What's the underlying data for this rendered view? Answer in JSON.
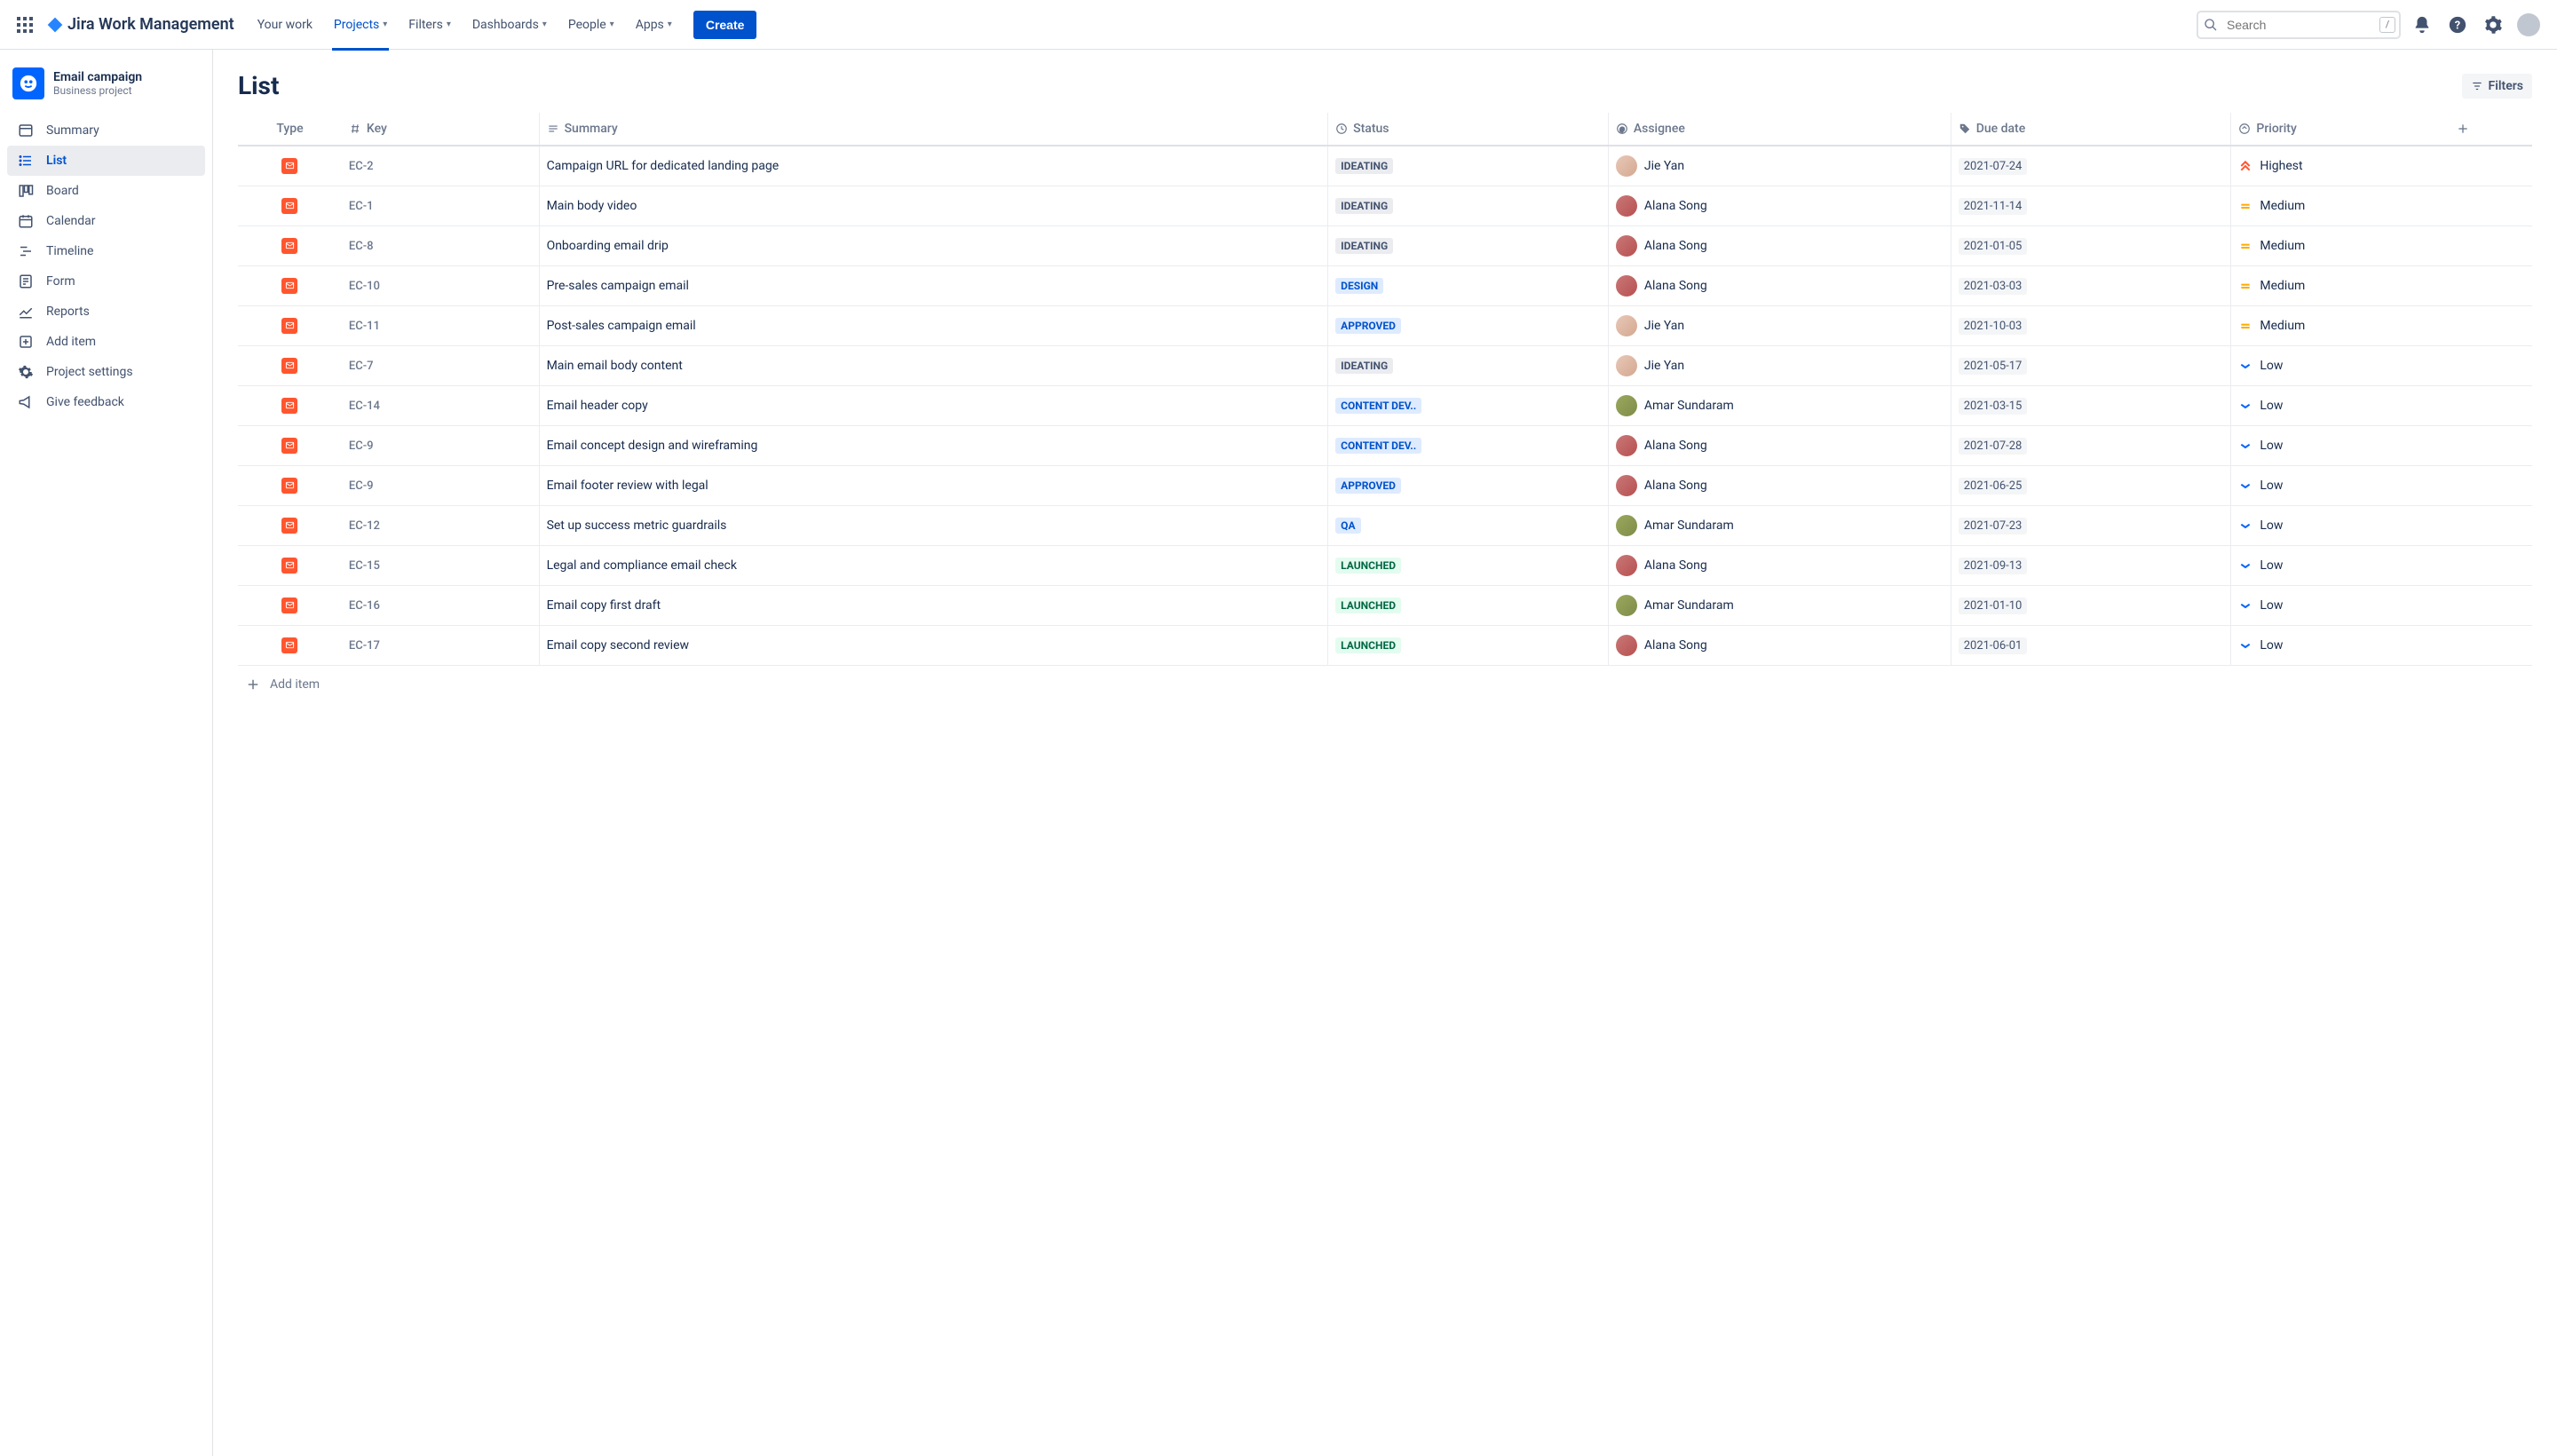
{
  "brand": "Jira Work Management",
  "nav": {
    "your_work": "Your work",
    "projects": "Projects",
    "filters": "Filters",
    "dashboards": "Dashboards",
    "people": "People",
    "apps": "Apps",
    "create": "Create"
  },
  "search": {
    "placeholder": "Search",
    "shortcut": "/"
  },
  "project": {
    "name": "Email campaign",
    "type": "Business project"
  },
  "sidebar": {
    "summary": "Summary",
    "list": "List",
    "board": "Board",
    "calendar": "Calendar",
    "timeline": "Timeline",
    "form": "Form",
    "reports": "Reports",
    "add_item": "Add item",
    "settings": "Project settings",
    "feedback": "Give feedback"
  },
  "page": {
    "title": "List",
    "filters": "Filters",
    "add_item": "Add item"
  },
  "columns": {
    "type": "Type",
    "key": "Key",
    "summary": "Summary",
    "status": "Status",
    "assignee": "Assignee",
    "due": "Due date",
    "priority": "Priority"
  },
  "assignees": {
    "jie": "Jie Yan",
    "alana": "Alana Song",
    "amar": "Amar Sundaram"
  },
  "priorities": {
    "highest": "Highest",
    "medium": "Medium",
    "low": "Low"
  },
  "rows": [
    {
      "key": "EC-2",
      "summary": "Campaign URL for dedicated landing page",
      "status": "IDEATING",
      "status_cls": "grey",
      "assignee": "jie",
      "due": "2021-07-24",
      "priority": "highest"
    },
    {
      "key": "EC-1",
      "summary": "Main body video",
      "status": "IDEATING",
      "status_cls": "grey",
      "assignee": "alana",
      "due": "2021-11-14",
      "priority": "medium"
    },
    {
      "key": "EC-8",
      "summary": "Onboarding email drip",
      "status": "IDEATING",
      "status_cls": "grey",
      "assignee": "alana",
      "due": "2021-01-05",
      "priority": "medium"
    },
    {
      "key": "EC-10",
      "summary": "Pre-sales campaign email",
      "status": "DESIGN",
      "status_cls": "blue",
      "assignee": "alana",
      "due": "2021-03-03",
      "priority": "medium"
    },
    {
      "key": "EC-11",
      "summary": "Post-sales campaign email",
      "status": "APPROVED",
      "status_cls": "blue",
      "assignee": "jie",
      "due": "2021-10-03",
      "priority": "medium"
    },
    {
      "key": "EC-7",
      "summary": "Main email body content",
      "status": "IDEATING",
      "status_cls": "grey",
      "assignee": "jie",
      "due": "2021-05-17",
      "priority": "low"
    },
    {
      "key": "EC-14",
      "summary": "Email header copy",
      "status": "CONTENT DEV..",
      "status_cls": "blue",
      "assignee": "amar",
      "due": "2021-03-15",
      "priority": "low"
    },
    {
      "key": "EC-9",
      "summary": "Email concept design and wireframing",
      "status": "CONTENT DEV..",
      "status_cls": "blue",
      "assignee": "alana",
      "due": "2021-07-28",
      "priority": "low"
    },
    {
      "key": "EC-9",
      "summary": "Email footer review with legal",
      "status": "APPROVED",
      "status_cls": "blue",
      "assignee": "alana",
      "due": "2021-06-25",
      "priority": "low"
    },
    {
      "key": "EC-12",
      "summary": "Set up success metric guardrails",
      "status": "QA",
      "status_cls": "blue",
      "assignee": "amar",
      "due": "2021-07-23",
      "priority": "low"
    },
    {
      "key": "EC-15",
      "summary": "Legal and compliance email check",
      "status": "LAUNCHED",
      "status_cls": "green",
      "assignee": "alana",
      "due": "2021-09-13",
      "priority": "low"
    },
    {
      "key": "EC-16",
      "summary": "Email copy first draft",
      "status": "LAUNCHED",
      "status_cls": "green",
      "assignee": "amar",
      "due": "2021-01-10",
      "priority": "low"
    },
    {
      "key": "EC-17",
      "summary": "Email copy second review",
      "status": "LAUNCHED",
      "status_cls": "green",
      "assignee": "alana",
      "due": "2021-06-01",
      "priority": "low"
    }
  ]
}
